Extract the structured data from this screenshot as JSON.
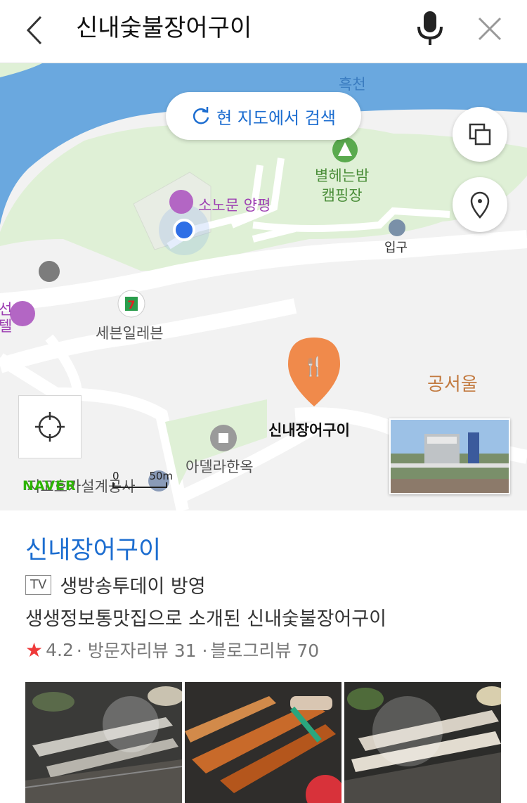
{
  "search": {
    "query": "신내숯불장어구이"
  },
  "icons": {
    "back": "chevron-left-icon",
    "mic": "microphone-icon",
    "clear": "close-icon"
  },
  "map": {
    "research_button": "현 지도에서 검색",
    "labels": {
      "heukcheon": "흑천",
      "camping": "별헤는밤\n캠핑장",
      "sonomun": "소노문 양평",
      "entrance": "입구",
      "seven_eleven": "세븐일레븐",
      "gongseoul": "공서울",
      "restaurant": "신내장어구이",
      "adella": "아델라한옥",
      "office": "지고호카설계공사",
      "left_edge": "선\n텔"
    },
    "scale": {
      "zero": "0",
      "distance": "50m"
    },
    "logo": "NAVER",
    "colors": {
      "water": "#6aa8df",
      "park": "#dff0d6",
      "road": "#ffffff",
      "pin": "#f08a4b",
      "purple": "#b366c4"
    }
  },
  "place": {
    "name": "신내장어구이",
    "tv_badge": "TV",
    "tv_text": "생방송투데이 방영",
    "description": "생생정보통맛집으로 소개된 신내숯불장어구이",
    "rating_star": "★",
    "rating": "4.2",
    "visitor_reviews": "· 방문자리뷰 31 ·",
    "blog_reviews": "블로그리뷰 70"
  }
}
